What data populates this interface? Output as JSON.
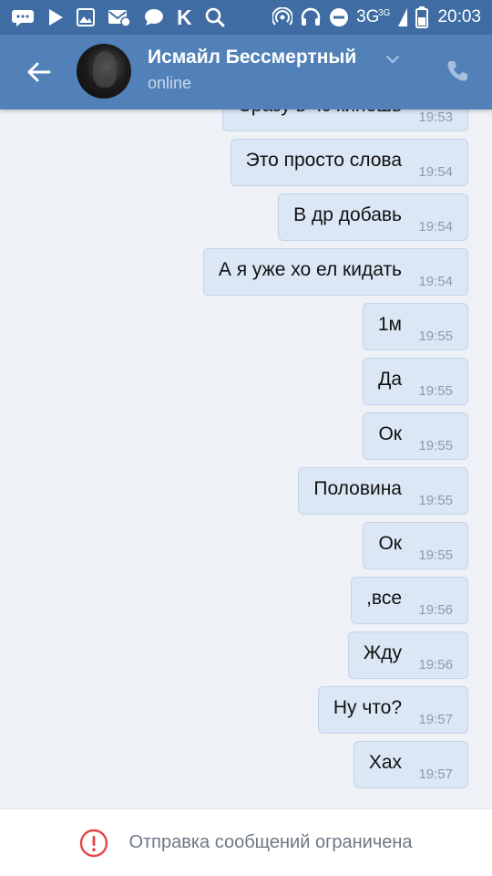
{
  "status_bar": {
    "time": "20:03",
    "network": "3G",
    "network_sup": "3G",
    "left_icons": [
      "chat-bubbles-icon",
      "play-icon",
      "image-icon",
      "mail-icon",
      "message-icon",
      "vk-logo-icon",
      "search-icon"
    ],
    "right_icons": [
      "hotspot-icon",
      "headset-icon",
      "do-not-disturb-icon",
      "signal-icon",
      "battery-icon"
    ]
  },
  "header": {
    "contact_name": "Исмайл Бессмертный",
    "status": "online",
    "back_icon": "arrow-left-icon",
    "call_icon": "phone-icon",
    "chevron_icon": "chevron-down-icon"
  },
  "messages": [
    {
      "text": "Сразу в чс кинешь",
      "time": "19:53"
    },
    {
      "text": "Это просто слова",
      "time": "19:54"
    },
    {
      "text": "В др добавь",
      "time": "19:54"
    },
    {
      "text": "А я уже хо ел кидать",
      "time": "19:54"
    },
    {
      "text": "1м",
      "time": "19:55"
    },
    {
      "text": "Да",
      "time": "19:55"
    },
    {
      "text": "Ок",
      "time": "19:55"
    },
    {
      "text": "Половина",
      "time": "19:55"
    },
    {
      "text": "Ок",
      "time": "19:55"
    },
    {
      "text": ",все",
      "time": "19:56"
    },
    {
      "text": "Жду",
      "time": "19:56"
    },
    {
      "text": "Ну что?",
      "time": "19:57"
    },
    {
      "text": "Хах",
      "time": "19:57"
    }
  ],
  "footer": {
    "notice": "Отправка сообщений ограничена",
    "icon": "alert-circle-icon",
    "icon_color": "#e64646"
  },
  "colors": {
    "status_bar": "#3f6da3",
    "header": "#5181b8",
    "bubble": "#dce7f6",
    "background": "#eef1f5"
  }
}
